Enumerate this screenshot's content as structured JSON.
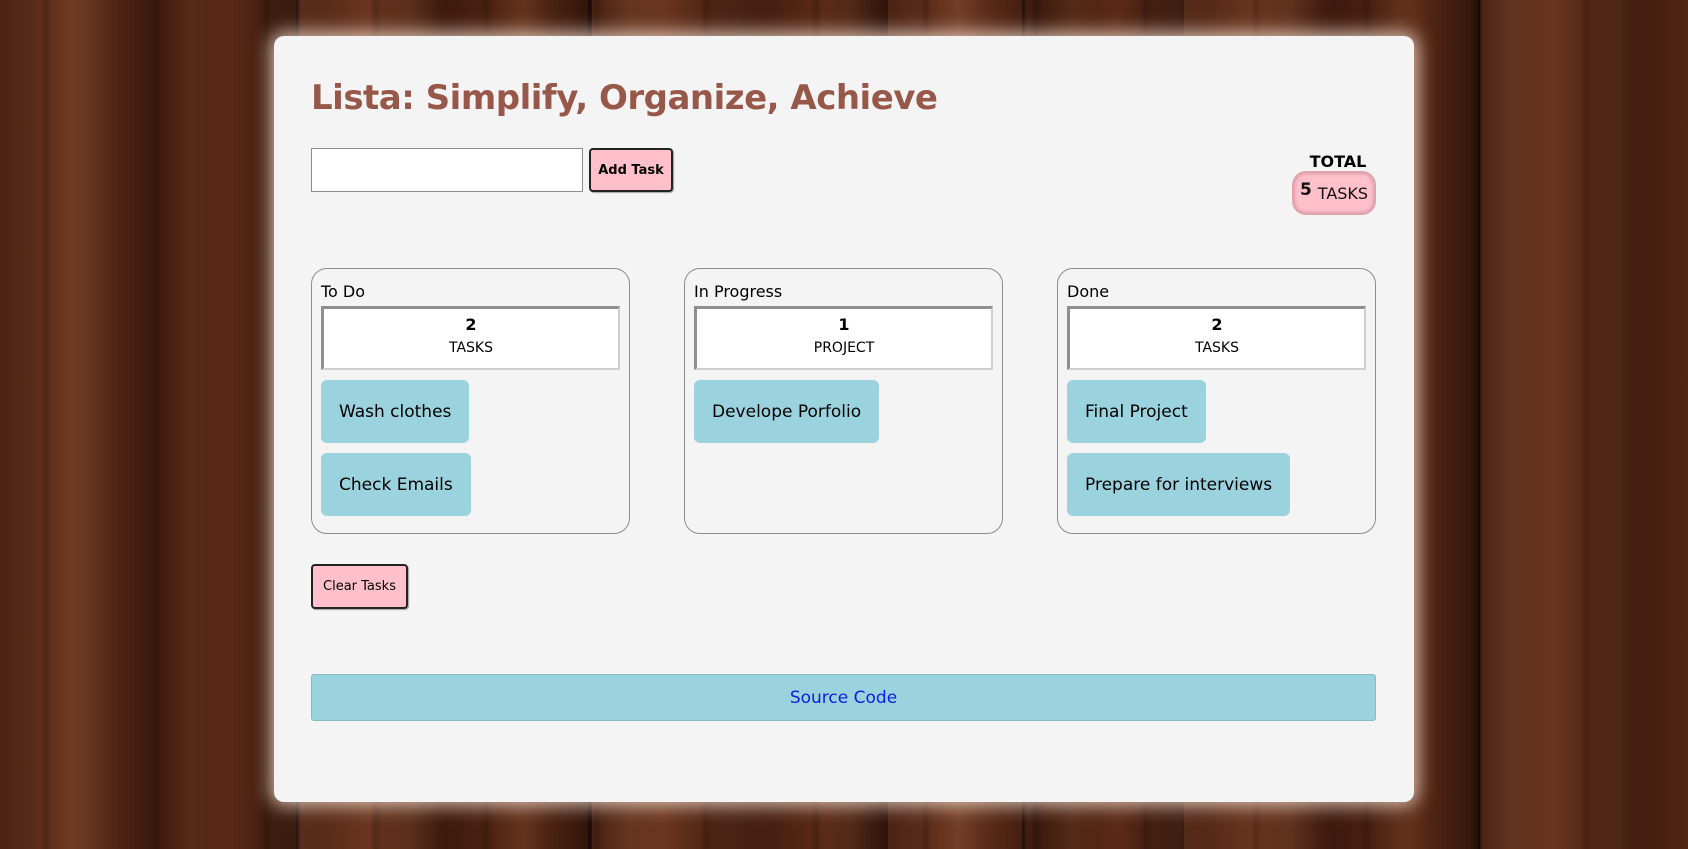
{
  "app": {
    "title": "Lista: Simplify, Organize, Achieve"
  },
  "form": {
    "input_value": "",
    "input_placeholder": "",
    "add_label": "Add Task"
  },
  "total": {
    "label": "TOTAL",
    "count": "5",
    "unit": "TASKS"
  },
  "columns": [
    {
      "title": "To Do",
      "count": "2",
      "unit": "TASKS",
      "tasks": [
        "Wash clothes",
        "Check Emails"
      ]
    },
    {
      "title": "In Progress",
      "count": "1",
      "unit": "PROJECT",
      "tasks": [
        "Develope Porfolio"
      ]
    },
    {
      "title": "Done",
      "count": "2",
      "unit": "TASKS",
      "tasks": [
        "Final Project",
        "Prepare for interviews"
      ]
    }
  ],
  "actions": {
    "clear_label": "Clear Tasks"
  },
  "footer": {
    "source_label": "Source Code"
  },
  "colors": {
    "title": "#97584a",
    "button_bg": "#ffc0cb",
    "card_bg": "#9ad2de",
    "link": "#0b1ee0",
    "panel_bg": "#f4f4f4"
  }
}
